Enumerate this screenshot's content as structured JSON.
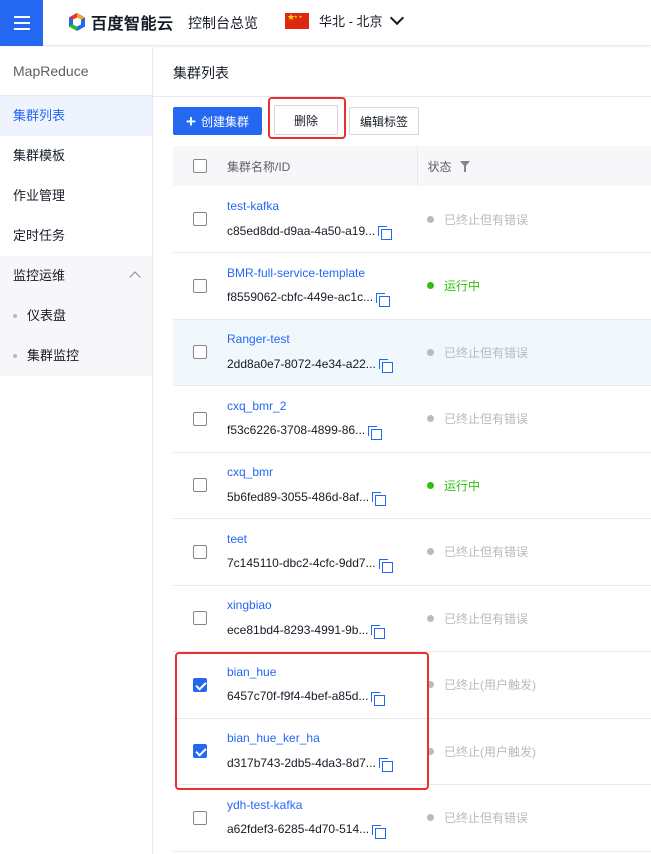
{
  "header": {
    "logo_text": "百度智能云",
    "console_link": "控制台总览",
    "region": "华北 - 北京"
  },
  "sidebar": {
    "title": "MapReduce",
    "items": [
      {
        "label": "集群列表"
      },
      {
        "label": "集群模板"
      },
      {
        "label": "作业管理"
      },
      {
        "label": "定时任务"
      }
    ],
    "group": {
      "label": "监控运维",
      "children": [
        {
          "label": "仪表盘"
        },
        {
          "label": "集群监控"
        }
      ]
    }
  },
  "main": {
    "title": "集群列表",
    "toolbar": {
      "create_label": "创建集群",
      "delete_label": "删除",
      "tag_label": "编辑标签"
    },
    "table": {
      "columns": [
        "集群名称/ID",
        "状态"
      ],
      "rows": [
        {
          "name": "test-kafka",
          "id": "c85ed8dd-d9aa-4a50-a19...",
          "status": "已终止但有错误",
          "checked": false
        },
        {
          "name": "BMR-full-service-template",
          "id": "f8559062-cbfc-449e-ac1c...",
          "status": "运行中",
          "checked": false
        },
        {
          "name": "Ranger-test",
          "id": "2dd8a0e7-8072-4e34-a22...",
          "status": "已终止但有错误",
          "checked": false
        },
        {
          "name": "cxq_bmr_2",
          "id": "f53c6226-3708-4899-86...",
          "status": "已终止但有错误",
          "checked": false
        },
        {
          "name": "cxq_bmr",
          "id": "5b6fed89-3055-486d-8af...",
          "status": "运行中",
          "checked": false
        },
        {
          "name": "teet",
          "id": "7c145110-dbc2-4cfc-9dd7...",
          "status": "已终止但有错误",
          "checked": false
        },
        {
          "name": "xingbiao",
          "id": "ece81bd4-8293-4991-9b...",
          "status": "已终止但有错误",
          "checked": false
        },
        {
          "name": "bian_hue",
          "id": "6457c70f-f9f4-4bef-a85d...",
          "status": "已终止(用户触发)",
          "checked": true
        },
        {
          "name": "bian_hue_ker_ha",
          "id": "d317b743-2db5-4da3-8d7...",
          "status": "已终止(用户触发)",
          "checked": true
        },
        {
          "name": "ydh-test-kafka",
          "id": "a62fdef3-6285-4d70-514...",
          "status": "已终止但有错误",
          "checked": false
        }
      ]
    }
  },
  "colors": {
    "accent": "#2468f2",
    "running": "#30bf13",
    "stopped": "#b8babf",
    "highlight": "#e7312d"
  }
}
